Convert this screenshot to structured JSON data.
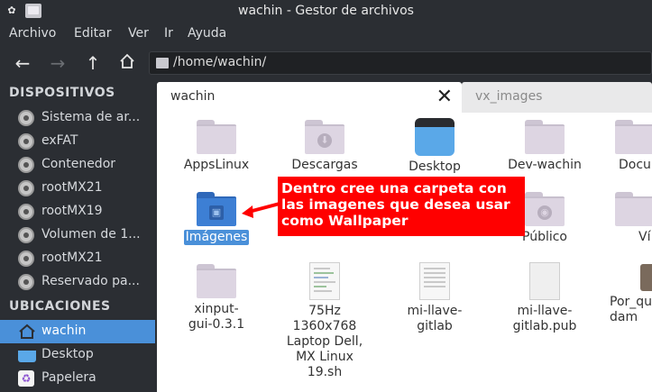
{
  "window": {
    "title": "wachin - Gestor de archivos"
  },
  "menu": [
    "Archivo",
    "Editar",
    "Ver",
    "Ir",
    "Ayuda"
  ],
  "toolbar": {
    "path": "/home/wachin/"
  },
  "sidebar": {
    "devices_header": "DISPOSITIVOS",
    "devices": [
      "Sistema de ar...",
      "exFAT",
      "Contenedor",
      "rootMX21",
      "rootMX19",
      "Volumen de 1...",
      "rootMX21",
      "Reservado pa..."
    ],
    "places_header": "UBICACIONES",
    "places": [
      "wachin",
      "Desktop",
      "Papelera"
    ]
  },
  "tabs": {
    "active": "wachin",
    "inactive": "vx_images"
  },
  "files": {
    "row1": [
      "AppsLinux",
      "Descargas",
      "Desktop",
      "Dev-wachin",
      "Docu"
    ],
    "row2": [
      "Imágenes",
      "Público",
      "Ví"
    ],
    "row3": [
      "xinput-gui-0.3.1",
      "75Hz 1360x768 Laptop Dell, MX Linux 19.sh",
      "mi-llave-gitlab",
      "mi-llave-gitlab.pub",
      "Por_qu dam"
    ]
  },
  "annotation": {
    "text": "Dentro cree una carpeta con las imagenes que desea usar como Wallpaper"
  },
  "colors": {
    "selection": "#4a90d9",
    "annotation": "#ff0000",
    "background": "#2b2e33"
  }
}
